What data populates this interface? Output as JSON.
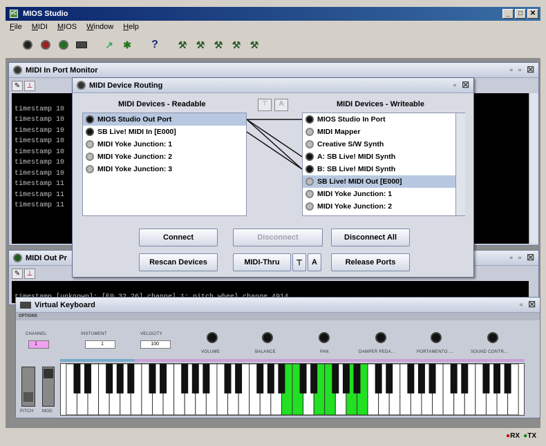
{
  "window": {
    "title": "MIOS Studio",
    "app_icon": "vC"
  },
  "menu": [
    "File",
    "MIDI",
    "MIOS",
    "Window",
    "Help"
  ],
  "in_monitor": {
    "title": "MIDI In Port Monitor",
    "lines": [
      "timestamp 10",
      "timestamp 10",
      "timestamp 10",
      "timestamp 10",
      "timestamp 10",
      "timestamp 10",
      "timestamp 10",
      "timestamp 11",
      "timestamp 11",
      "timestamp 11"
    ]
  },
  "routing": {
    "title": "MIDI Device Routing",
    "readable_label": "MIDI Devices - Readable",
    "writeable_label": "MIDI Devices - Writeable",
    "readable": [
      {
        "name": "MIOS Studio Out Port",
        "active": true,
        "selected": true
      },
      {
        "name": "SB Live! MIDI In [E000]",
        "active": true,
        "selected": false
      },
      {
        "name": "MIDI Yoke Junction: 1",
        "active": false,
        "selected": false
      },
      {
        "name": "MIDI Yoke Junction: 2",
        "active": false,
        "selected": false
      },
      {
        "name": "MIDI Yoke Junction: 3",
        "active": false,
        "selected": false
      }
    ],
    "writeable": [
      {
        "name": "MIOS Studio In Port",
        "active": true,
        "selected": false
      },
      {
        "name": "MIDI Mapper",
        "active": false,
        "selected": false
      },
      {
        "name": "Creative S/W Synth",
        "active": false,
        "selected": false
      },
      {
        "name": "A: SB Live! MIDI Synth",
        "active": true,
        "selected": false
      },
      {
        "name": "B: SB Live! MIDI Synth",
        "active": true,
        "selected": false
      },
      {
        "name": "SB Live! MIDI Out [E000]",
        "active": false,
        "selected": true
      },
      {
        "name": "MIDI Yoke Junction: 1",
        "active": false,
        "selected": false
      },
      {
        "name": "MIDI Yoke Junction: 2",
        "active": false,
        "selected": false
      }
    ],
    "buttons": {
      "connect": "Connect",
      "disconnect": "Disconnect",
      "disconnect_all": "Disconnect All",
      "rescan": "Rescan Devices",
      "midi_thru": "MIDI-Thru",
      "release": "Release Ports"
    }
  },
  "out_monitor": {
    "title": "MIDI Out Pr",
    "line": "timestamp [unknown]: [E0 32 26] channel 1: pitch wheel change 4914"
  },
  "keyboard": {
    "title": "Virtual Keyboard",
    "options_label": "OPTIONS",
    "channel_label": "CHANNEL",
    "channel_value": "1",
    "instrument_label": "INSTUMENT",
    "instrument_value": "1",
    "velocity_label": "VELOCITY",
    "velocity_value": "100",
    "knobs": [
      "VOLUME",
      "BALANCE",
      "PAN",
      "DAMPER PEDA...",
      "PORTAMENTO ...",
      "SOUND CONTR..."
    ],
    "pitch_label": "PITCH",
    "mod_label": "MOD",
    "pressed_white_keys": [
      20,
      21,
      23,
      24,
      26,
      27
    ]
  },
  "status": {
    "rx": "RX",
    "tx": "TX",
    "rx_color": "#c00000",
    "tx_color": "#008000"
  }
}
